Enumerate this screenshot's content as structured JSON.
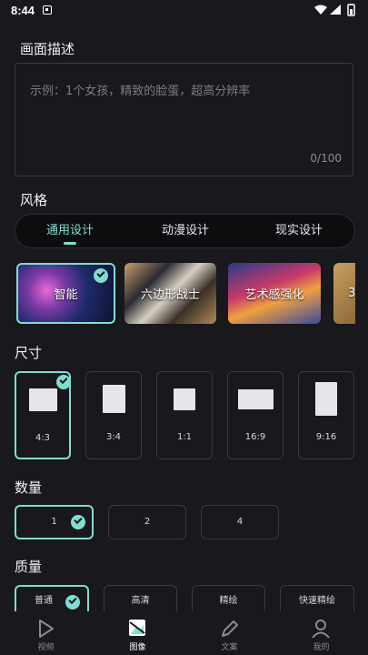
{
  "status_bar": {
    "time": "8:44",
    "icons": [
      "notification-icon",
      "wifi-icon",
      "signal-icon",
      "battery-icon"
    ]
  },
  "description": {
    "title": "画面描述",
    "placeholder": "示例：1个女孩，精致的脸蛋，超高分辨率",
    "value": "",
    "counter": "0/100"
  },
  "style": {
    "title": "风格",
    "tabs": [
      {
        "label": "通用设计",
        "active": true
      },
      {
        "label": "动漫设计",
        "active": false
      },
      {
        "label": "现实设计",
        "active": false
      }
    ],
    "cards": [
      {
        "label": "智能",
        "selected": true
      },
      {
        "label": "六边形战士",
        "selected": false
      },
      {
        "label": "艺术感强化",
        "selected": false
      },
      {
        "label": "3",
        "selected": false
      }
    ]
  },
  "size": {
    "title": "尺寸",
    "options": [
      {
        "label": "4:3",
        "selected": true
      },
      {
        "label": "3:4",
        "selected": false
      },
      {
        "label": "1:1",
        "selected": false
      },
      {
        "label": "16:9",
        "selected": false
      },
      {
        "label": "9:16",
        "selected": false
      }
    ]
  },
  "quantity": {
    "title": "数量",
    "options": [
      {
        "label": "1",
        "selected": true
      },
      {
        "label": "2",
        "selected": false
      },
      {
        "label": "4",
        "selected": false
      }
    ]
  },
  "quality": {
    "title": "质量",
    "options": [
      {
        "label": "普通",
        "selected": true
      },
      {
        "label": "高清",
        "selected": false
      },
      {
        "label": "精绘",
        "selected": false
      },
      {
        "label": "快速精绘",
        "selected": false
      }
    ]
  },
  "bottom_nav": [
    {
      "label": "视频",
      "icon": "play-icon",
      "active": false
    },
    {
      "label": "图像",
      "icon": "image-icon",
      "active": true
    },
    {
      "label": "文案",
      "icon": "pencil-icon",
      "active": false
    },
    {
      "label": "我的",
      "icon": "user-icon",
      "active": false
    }
  ],
  "colors": {
    "accent": "#7fded0",
    "background": "#18181d",
    "border": "#3a3a40"
  }
}
